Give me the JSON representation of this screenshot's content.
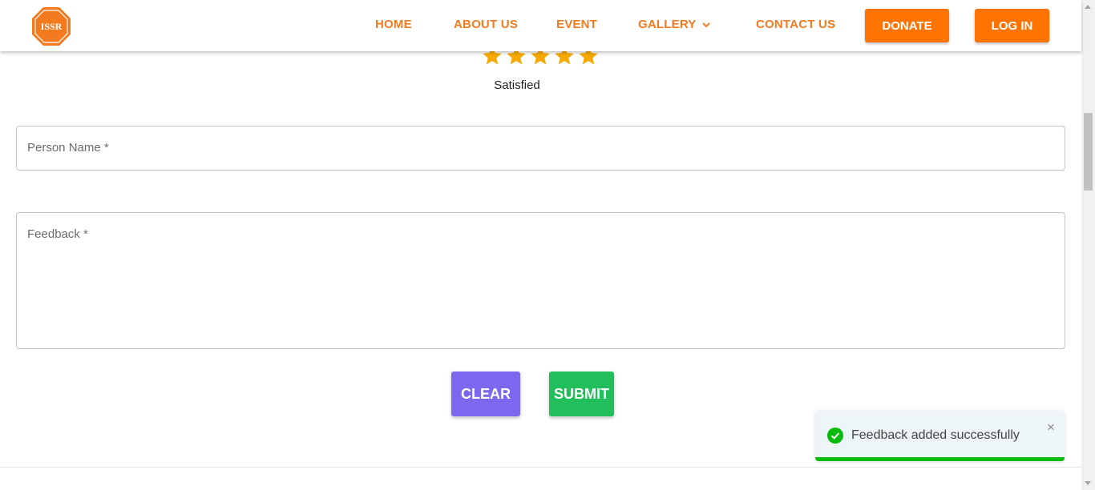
{
  "header": {
    "logo_text": "ISSR",
    "nav": [
      "HOME",
      "ABOUT US",
      "EVENT",
      "GALLERY",
      "CONTACT US"
    ],
    "donate_label": "DONATE",
    "login_label": "LOG IN",
    "accent_color": "#f47a1f"
  },
  "rating": {
    "stars_filled": 5,
    "stars_total": 5,
    "label": "Satisfied",
    "star_color": "#f5a800"
  },
  "form": {
    "name_label": "Person Name *",
    "feedback_label": "Feedback *",
    "clear_label": "CLEAR",
    "submit_label": "SUBMIT",
    "clear_color": "#7b68ee",
    "submit_color": "#21bf5b"
  },
  "toast": {
    "message": "Feedback added successfully",
    "close_glyph": "×",
    "icon": "check-circle-icon",
    "success_color": "#07bc0c"
  }
}
